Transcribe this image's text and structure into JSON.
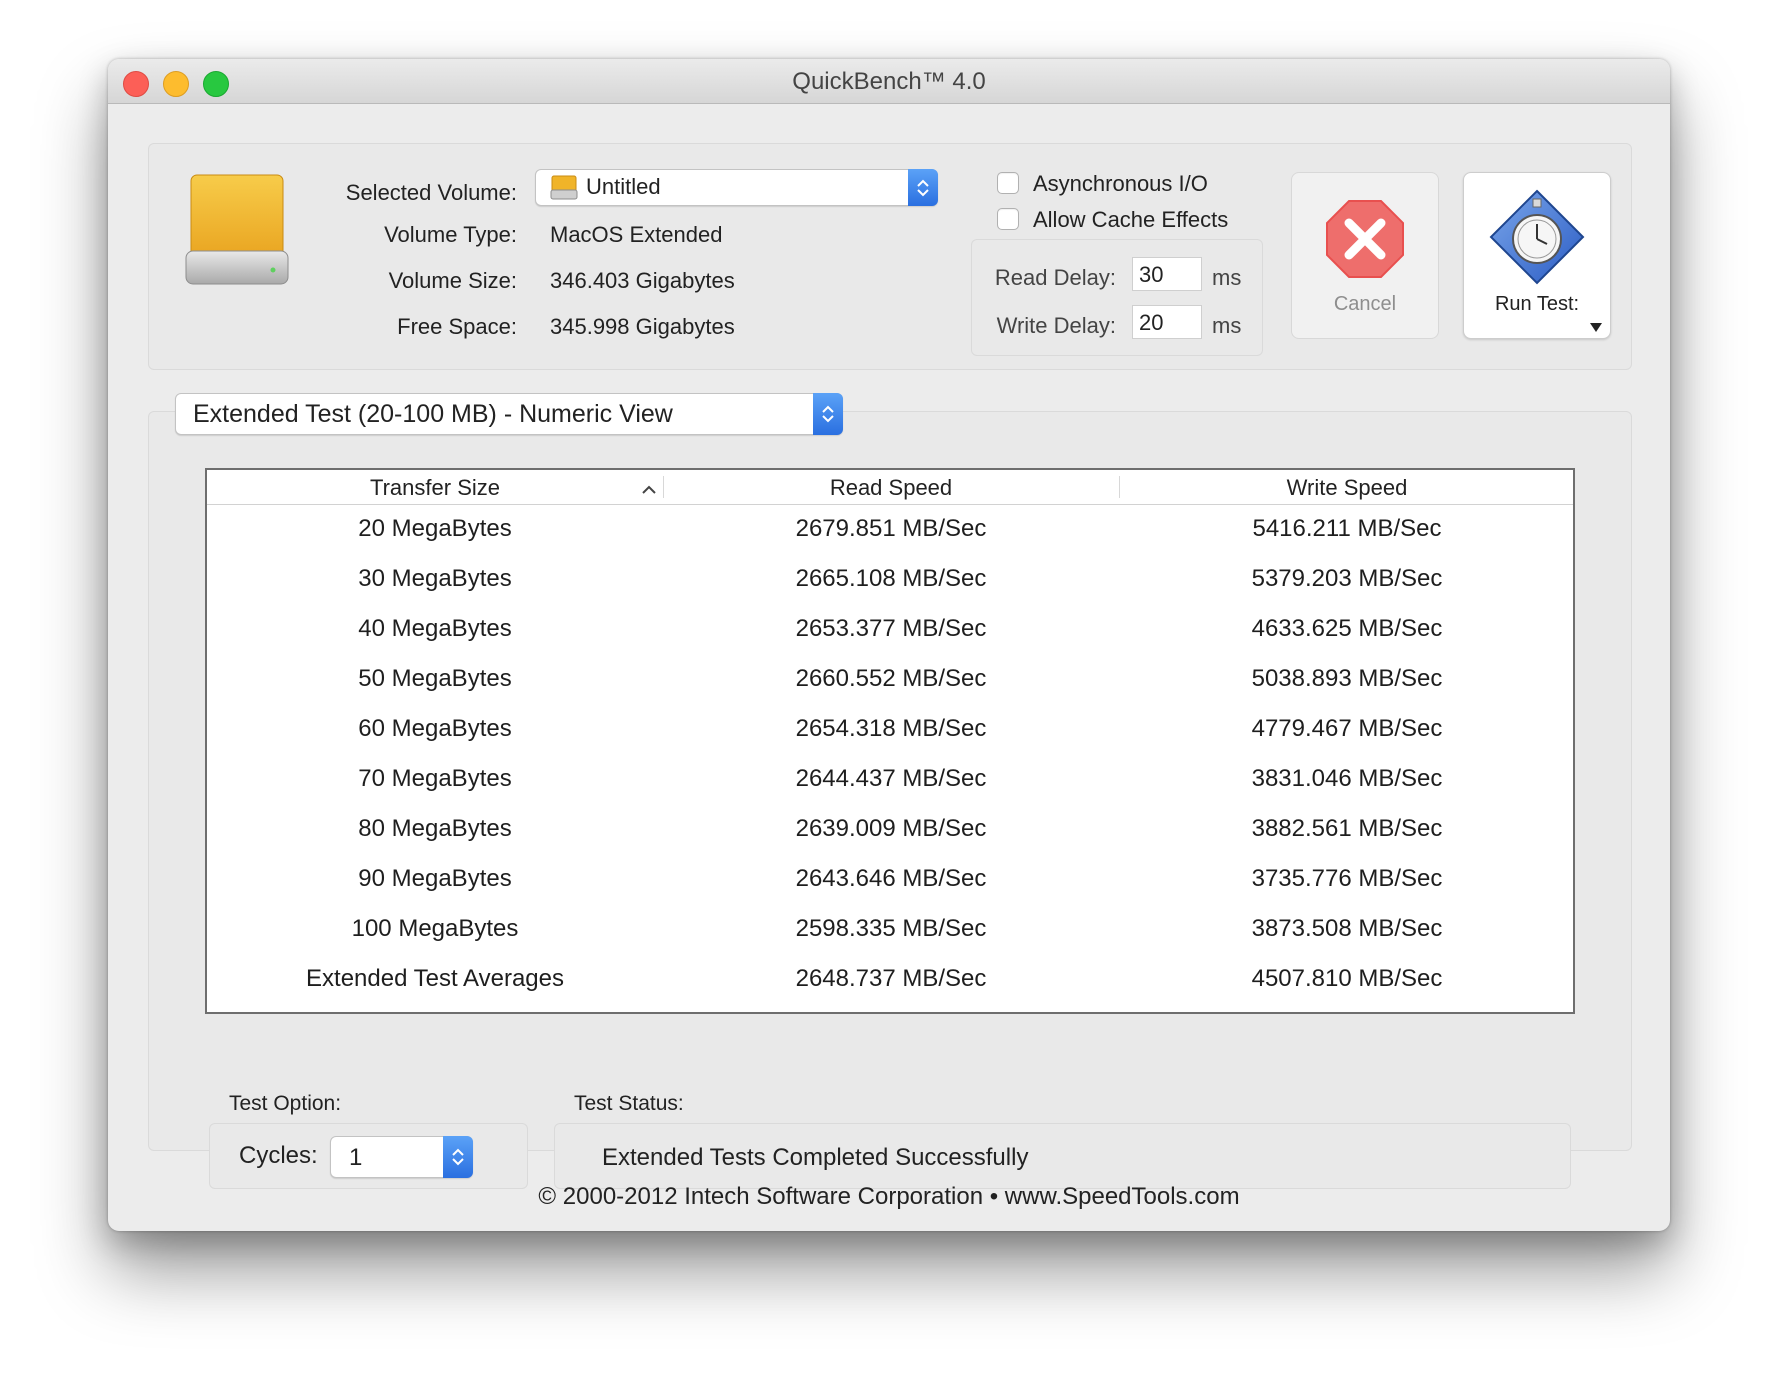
{
  "window": {
    "title": "QuickBench™ 4.0"
  },
  "volume": {
    "selected_label": "Selected Volume:",
    "selected_value": "Untitled",
    "type_label": "Volume Type:",
    "type_value": "MacOS Extended",
    "size_label": "Volume Size:",
    "size_value": "346.403 Gigabytes",
    "free_label": "Free Space:",
    "free_value": "345.998 Gigabytes"
  },
  "options": {
    "async_label": "Asynchronous I/O",
    "async_checked": false,
    "cache_label": "Allow Cache Effects",
    "cache_checked": false,
    "read_delay_label": "Read Delay:",
    "read_delay_value": "30",
    "write_delay_label": "Write Delay:",
    "write_delay_value": "20",
    "unit": "ms"
  },
  "buttons": {
    "cancel_label": "Cancel",
    "run_label": "Run Test:"
  },
  "view_selector": {
    "value": "Extended Test (20-100 MB) - Numeric View"
  },
  "table": {
    "headers": [
      "Transfer Size",
      "Read Speed",
      "Write Speed"
    ],
    "sort_column": "Transfer Size",
    "sort_direction": "ascending",
    "rows": [
      [
        "20 MegaBytes",
        "2679.851 MB/Sec",
        "5416.211 MB/Sec"
      ],
      [
        "30 MegaBytes",
        "2665.108 MB/Sec",
        "5379.203 MB/Sec"
      ],
      [
        "40 MegaBytes",
        "2653.377 MB/Sec",
        "4633.625 MB/Sec"
      ],
      [
        "50 MegaBytes",
        "2660.552 MB/Sec",
        "5038.893 MB/Sec"
      ],
      [
        "60 MegaBytes",
        "2654.318 MB/Sec",
        "4779.467 MB/Sec"
      ],
      [
        "70 MegaBytes",
        "2644.437 MB/Sec",
        "3831.046 MB/Sec"
      ],
      [
        "80 MegaBytes",
        "2639.009 MB/Sec",
        "3882.561 MB/Sec"
      ],
      [
        "90 MegaBytes",
        "2643.646 MB/Sec",
        "3735.776 MB/Sec"
      ],
      [
        "100 MegaBytes",
        "2598.335 MB/Sec",
        "3873.508 MB/Sec"
      ],
      [
        "Extended Test Averages",
        "2648.737 MB/Sec",
        "4507.810 MB/Sec"
      ]
    ]
  },
  "test_option": {
    "label": "Test Option:",
    "cycles_label": "Cycles:",
    "cycles_value": "1"
  },
  "test_status": {
    "label": "Test Status:",
    "value": "Extended Tests Completed Successfully"
  },
  "footer": "© 2000-2012 Intech Software Corporation • www.SpeedTools.com",
  "icons": [
    "drive-icon",
    "volume-drive-icon",
    "popup-stepper-icon",
    "cancel-x-icon",
    "stopwatch-icon",
    "dropdown-arrow-icon",
    "sort-ascending-icon"
  ],
  "colors": {
    "accent": "#2f78e6",
    "cancel_red": "#e8504f",
    "drive_yellow": "#f0b429"
  }
}
